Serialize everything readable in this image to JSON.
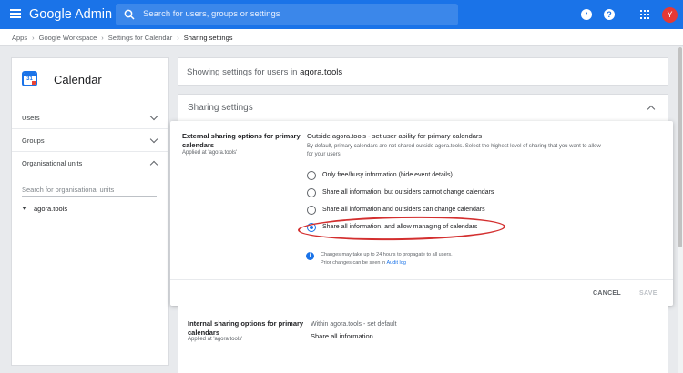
{
  "header": {
    "brand": "Google Admin",
    "search_placeholder": "Search for users, groups or settings",
    "avatar_letter": "Y"
  },
  "breadcrumb": [
    "Apps",
    "Google Workspace",
    "Settings for Calendar",
    "Sharing settings"
  ],
  "sidebar": {
    "app_icon_number": "31",
    "app_name": "Calendar",
    "items": [
      {
        "label": "Users",
        "icon": "chevron-down-icon"
      },
      {
        "label": "Groups",
        "icon": "chevron-down-icon"
      },
      {
        "label": "Organisational units",
        "icon": "chevron-up-icon"
      }
    ],
    "ou_search_placeholder": "Search for organisational units",
    "ou_root": "agora.tools"
  },
  "main": {
    "showing_prefix": "Showing settings for users in ",
    "showing_domain": "agora.tools",
    "section_title": "Sharing settings",
    "external": {
      "title": "External sharing options for primary calendars",
      "applied": "Applied at 'agora.tools'",
      "option_heading": "Outside agora.tools - set user ability for primary calendars",
      "description": "By default, primary calendars are not shared outside agora.tools. Select the highest level of sharing that you want to allow for your users.",
      "options": [
        {
          "label": "Only free/busy information (hide event details)",
          "selected": false
        },
        {
          "label": "Share all information, but outsiders cannot change calendars",
          "selected": false
        },
        {
          "label": "Share all information and outsiders can change calendars",
          "selected": false
        },
        {
          "label": "Share all information, and allow managing of calendars",
          "selected": true
        }
      ],
      "info_line1": "Changes may take up to 24 hours to propagate to all users.",
      "info_line2_prefix": "Prior changes can be seen in ",
      "info_link": "Audit log",
      "cancel_label": "CANCEL",
      "save_label": "SAVE"
    },
    "internal": {
      "title": "Internal sharing options for primary calendars",
      "applied": "Applied at 'agora.tools'",
      "option_heading": "Within agora.tools - set default",
      "value": "Share all information"
    }
  },
  "colors": {
    "brand_blue": "#1a73e8",
    "highlight_red": "#d32f2f",
    "avatar_red": "#e53935"
  }
}
